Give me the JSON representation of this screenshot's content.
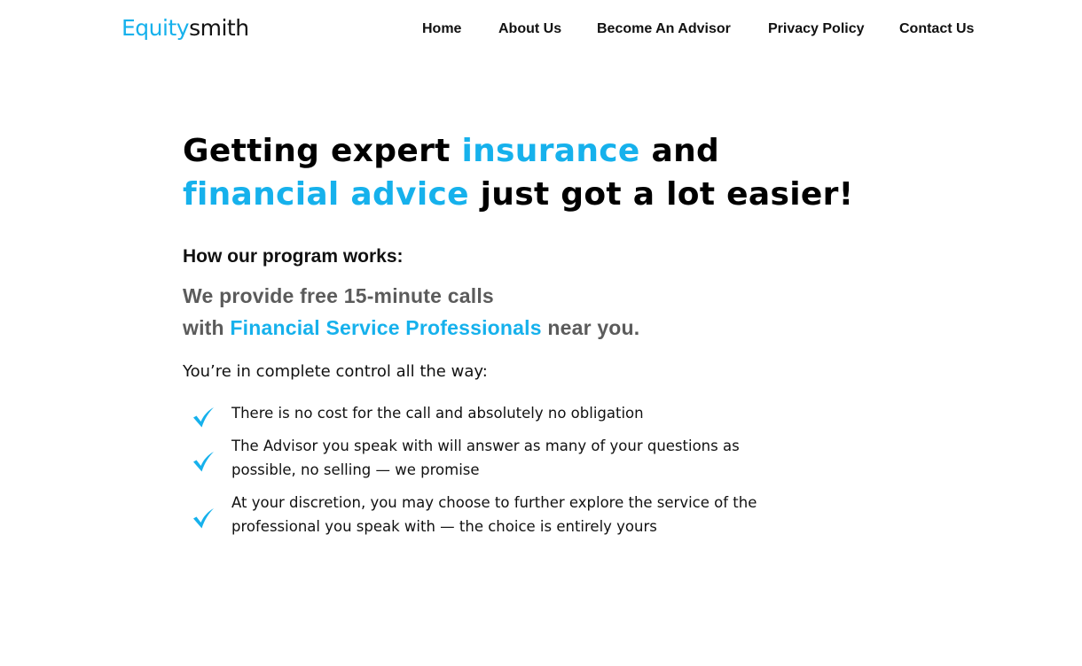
{
  "header": {
    "logo": {
      "part1": "Equity",
      "part2": "smith"
    },
    "nav": [
      {
        "label": "Home"
      },
      {
        "label": "About Us"
      },
      {
        "label": "Become An Advisor"
      },
      {
        "label": "Privacy Policy"
      },
      {
        "label": "Contact Us"
      }
    ]
  },
  "hero": {
    "headline": {
      "line1_a": "Getting expert ",
      "line1_accent": "insurance",
      "line1_b": " and",
      "line2_accent": "financial advice",
      "line2_b": " just got a lot easier!"
    },
    "how_title": "How our program works:",
    "provide": {
      "line1": "We provide free 15-minute calls",
      "line2_a": "with ",
      "line2_accent": "Financial Service Professionals",
      "line2_b": " near you."
    },
    "control_title": "You’re in complete control all the way:",
    "checklist": [
      {
        "icon": "checkmark-icon",
        "line1": "There is no cost for the call and absolutely no obligation"
      },
      {
        "icon": "checkmark-icon",
        "line1": "The Advisor you speak with will answer as many of  your questions as",
        "line2": "possible, no selling — we promise"
      },
      {
        "icon": "checkmark-icon",
        "line1": "At your discretion, you may choose to further explore the service of the",
        "line2": "professional you speak with — the choice is entirely yours"
      }
    ]
  },
  "colors": {
    "accent": "#16b1ec",
    "text": "#111111",
    "muted": "#5b5b5b",
    "background": "#ffffff"
  }
}
